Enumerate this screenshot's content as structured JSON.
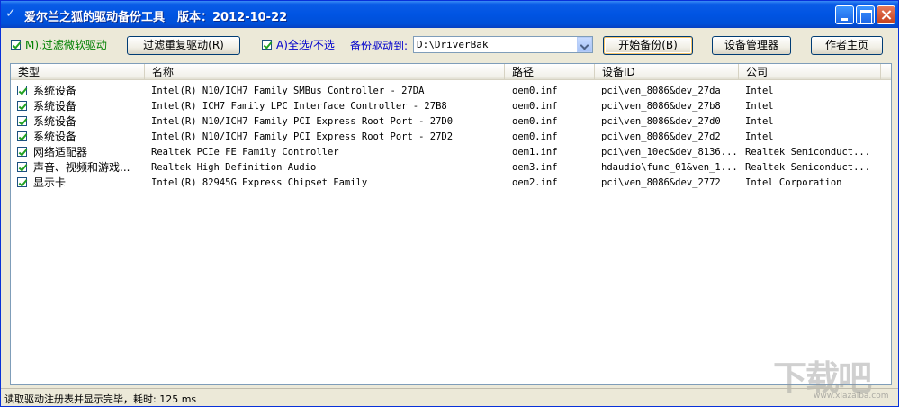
{
  "window": {
    "title": "爱尔兰之狐的驱动备份工具",
    "version": "版本：2012-10-22",
    "controls": [
      "minimize",
      "maximize",
      "close"
    ]
  },
  "toolbar": {
    "filter_ms": {
      "key": "M)",
      "text": ".过滤微软驱动",
      "checked": true
    },
    "filter_dup_button": {
      "text": "过滤重复驱动",
      "key": "(R)"
    },
    "select_all": {
      "key": "A)",
      "text": "全选/不选",
      "checked": true
    },
    "path_label": "备份驱动到:",
    "path_value": "D:\\DriverBak",
    "start_button": {
      "text": "开始备份",
      "key": "(B)"
    },
    "device_manager_button": "设备管理器",
    "author_button": "作者主页"
  },
  "list": {
    "columns": [
      "类型",
      "名称",
      "路径",
      "设备ID",
      "公司"
    ],
    "rows": [
      {
        "checked": true,
        "type": "系统设备",
        "name": "Intel(R) N10/ICH7 Family SMBus Controller - 27DA",
        "path": "oem0.inf",
        "device_id": "pci\\ven_8086&dev_27da",
        "company": "Intel"
      },
      {
        "checked": true,
        "type": "系统设备",
        "name": "Intel(R) ICH7 Family LPC Interface Controller - 27B8",
        "path": "oem0.inf",
        "device_id": "pci\\ven_8086&dev_27b8",
        "company": "Intel"
      },
      {
        "checked": true,
        "type": "系统设备",
        "name": "Intel(R) N10/ICH7 Family PCI Express Root Port - 27D0",
        "path": "oem0.inf",
        "device_id": "pci\\ven_8086&dev_27d0",
        "company": "Intel"
      },
      {
        "checked": true,
        "type": "系统设备",
        "name": "Intel(R) N10/ICH7 Family PCI Express Root Port - 27D2",
        "path": "oem0.inf",
        "device_id": "pci\\ven_8086&dev_27d2",
        "company": "Intel"
      },
      {
        "checked": true,
        "type": "网络适配器",
        "name": "Realtek PCIe FE Family Controller",
        "path": "oem1.inf",
        "device_id": "pci\\ven_10ec&dev_8136...",
        "company": "Realtek Semiconduct..."
      },
      {
        "checked": true,
        "type": "声音、视频和游戏...",
        "name": "Realtek High Definition Audio",
        "path": "oem3.inf",
        "device_id": "hdaudio\\func_01&ven_1...",
        "company": "Realtek Semiconduct..."
      },
      {
        "checked": true,
        "type": "显示卡",
        "name": "Intel(R) 82945G Express Chipset Family",
        "path": "oem2.inf",
        "device_id": "pci\\ven_8086&dev_2772",
        "company": "Intel Corporation"
      }
    ]
  },
  "status": "读取驱动注册表并显示完毕，耗时: 125 ms",
  "watermark": {
    "text": "下载吧",
    "sub": "www.xiazaiba.com"
  },
  "colors": {
    "titlebar": "#0054e3",
    "option_text": "#008000",
    "path_label": "#0000cc",
    "face": "#ece9d8"
  }
}
